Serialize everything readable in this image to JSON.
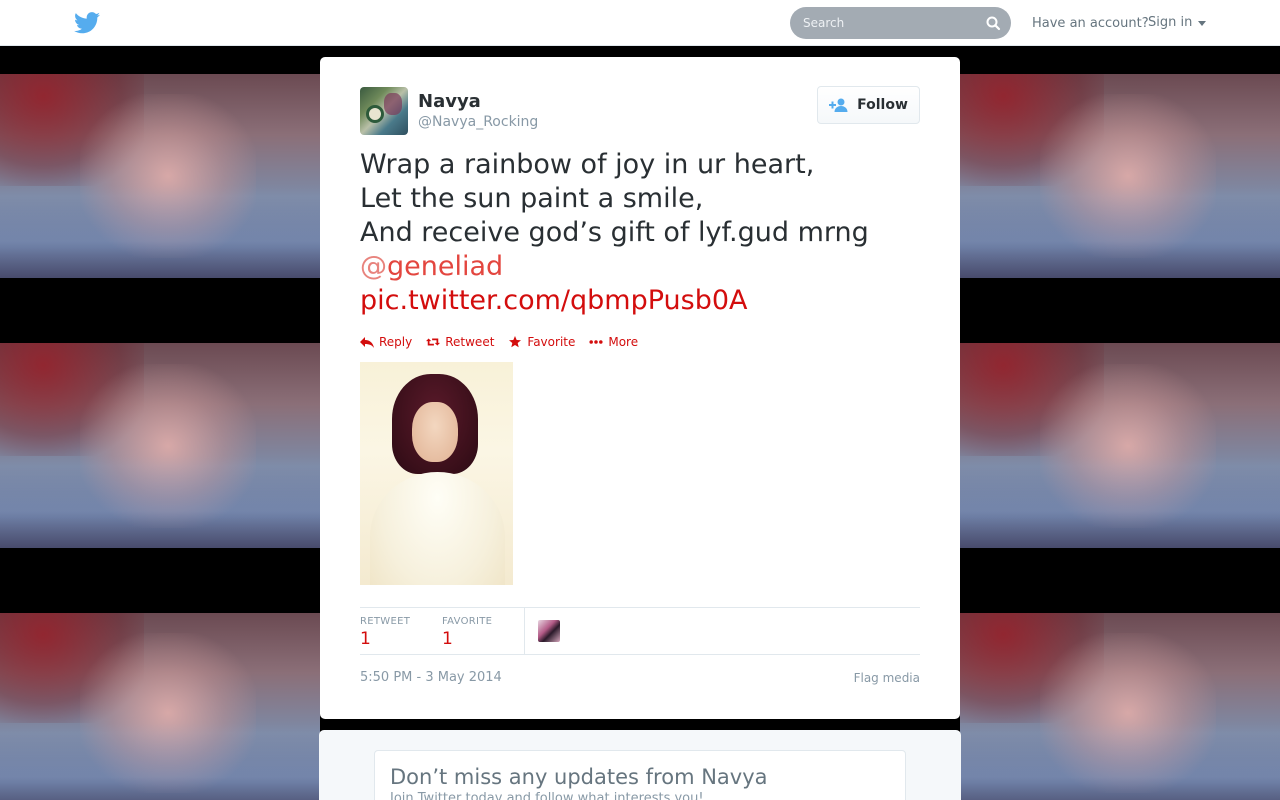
{
  "header": {
    "logo_icon": "twitter-bird-icon",
    "search_placeholder": "Search",
    "have_account": "Have an account?",
    "sign_in": "Sign in"
  },
  "tweet": {
    "author_name": "Navya",
    "author_handle": "@Navya_Rocking",
    "follow_label": "Follow",
    "text_lines": [
      "Wrap a rainbow of joy in ur heart,",
      "Let the sun paint a smile,",
      "And receive god’s gift of lyf.gud mrng"
    ],
    "mention_at": "@",
    "mention_name": "geneliad",
    "link": "pic.twitter.com/qbmpPusb0A",
    "actions": {
      "reply": "Reply",
      "retweet": "Retweet",
      "favorite": "Favorite",
      "more": "More"
    },
    "stats": {
      "retweet_label": "RETWEET",
      "retweet_count": "1",
      "favorite_label": "FAVORITE",
      "favorite_count": "1"
    },
    "timestamp": "5:50 PM - 3 May 2014",
    "flag_media": "Flag media"
  },
  "signup": {
    "title": "Don’t miss any updates from Navya",
    "subtitle": "Join Twitter today and follow what interests you!"
  },
  "colors": {
    "link_red": "#d30d0d",
    "twitter_blue": "#55acee",
    "text_dark": "#292f33",
    "text_muted": "#8899a6"
  }
}
